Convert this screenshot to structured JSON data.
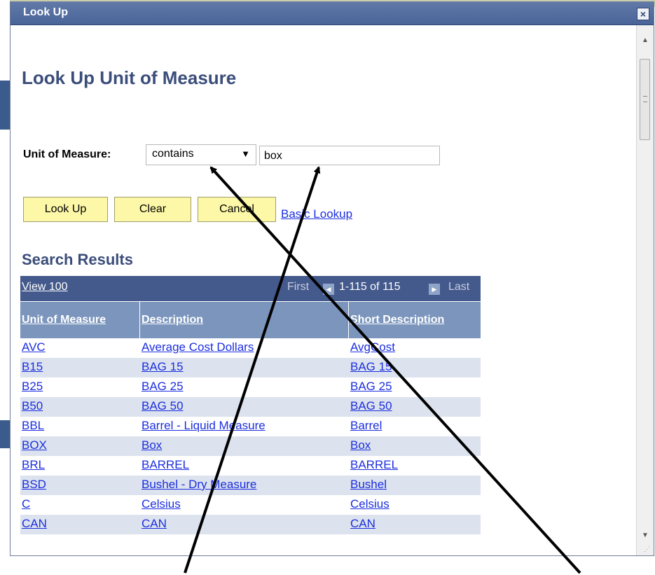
{
  "dialog": {
    "title": "Look Up",
    "close_label": "×"
  },
  "page": {
    "title": "Look Up Unit of Measure"
  },
  "search": {
    "field_label": "Unit of Measure:",
    "operator": "contains",
    "value": "box"
  },
  "buttons": {
    "lookup": "Look Up",
    "clear": "Clear",
    "cancel": "Cancel",
    "basic_lookup": "Basic Lookup"
  },
  "results": {
    "title": "Search Results",
    "view_label": "View 100",
    "first_label": "First",
    "count_label": "1-115 of 115",
    "last_label": "Last",
    "columns": [
      "Unit of Measure",
      "Description",
      "Short Description"
    ],
    "rows": [
      [
        "AVC",
        "Average Cost Dollars",
        "AvgCost"
      ],
      [
        "B15",
        "BAG 15",
        "BAG 15"
      ],
      [
        "B25",
        "BAG 25",
        "BAG 25"
      ],
      [
        "B50",
        "BAG 50",
        "BAG 50"
      ],
      [
        "BBL",
        "Barrel - Liquid Measure",
        "Barrel"
      ],
      [
        "BOX",
        "Box",
        "Box"
      ],
      [
        "BRL",
        "BARREL",
        "BARREL"
      ],
      [
        "BSD",
        "Bushel - Dry Measure",
        "Bushel"
      ],
      [
        "C",
        "Celsius",
        "Celsius"
      ],
      [
        "CAN",
        "CAN",
        "CAN"
      ]
    ]
  },
  "colors": {
    "title_bar": "#4a6499",
    "heading": "#3b4d7a",
    "nav_bar": "#44598c",
    "header": "#7b95bd",
    "alt_row": "#dce3ee",
    "button": "#fdf8a8",
    "link": "#1c2ee0"
  }
}
